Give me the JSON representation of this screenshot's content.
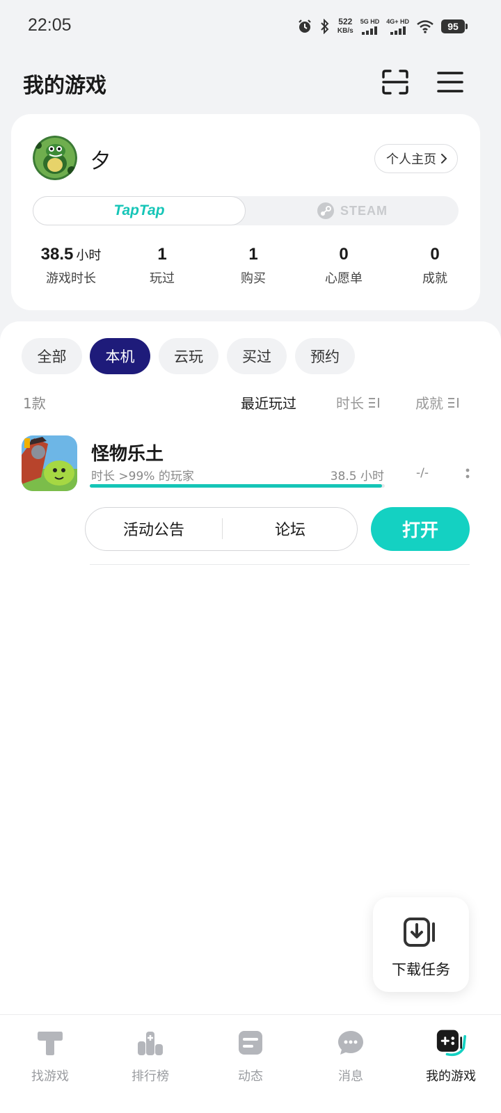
{
  "status_bar": {
    "time": "22:05",
    "speed_value": "522",
    "speed_unit": "KB/s",
    "sim1_label": "5G HD",
    "sim2_label": "4G+ HD",
    "battery": "95"
  },
  "header": {
    "title": "我的游戏",
    "icons": [
      "scan-icon",
      "menu-icon"
    ]
  },
  "profile": {
    "username": "夕",
    "home_button": "个人主页",
    "platforms": {
      "active": "TapTap",
      "inactive": "STEAM"
    },
    "stats": [
      {
        "value": "38.5",
        "unit": "小时",
        "label": "游戏时长"
      },
      {
        "value": "1",
        "unit": "",
        "label": "玩过"
      },
      {
        "value": "1",
        "unit": "",
        "label": "购买"
      },
      {
        "value": "0",
        "unit": "",
        "label": "心愿单"
      },
      {
        "value": "0",
        "unit": "",
        "label": "成就"
      }
    ]
  },
  "filters": {
    "items": [
      "全部",
      "本机",
      "云玩",
      "买过",
      "预约"
    ],
    "selected": "本机"
  },
  "list_header": {
    "count": "1款",
    "sort": [
      "最近玩过",
      "时长",
      "成就"
    ],
    "active_sort": "最近玩过"
  },
  "games": [
    {
      "title": "怪物乐土",
      "subtitle": "时长 >99% 的玩家",
      "hours": "38.5 小时",
      "achievement": "-/-",
      "playtime_percentile": 0.99,
      "links": [
        "活动公告",
        "论坛"
      ],
      "action": "打开"
    }
  ],
  "download_task": {
    "label": "下载任务"
  },
  "bottom_nav": {
    "items": [
      "找游戏",
      "排行榜",
      "动态",
      "消息",
      "我的游戏"
    ],
    "active": "我的游戏"
  },
  "colors": {
    "accent": "#14d1c2",
    "filter_active": "#1e1b7a",
    "background": "#f2f3f5"
  }
}
